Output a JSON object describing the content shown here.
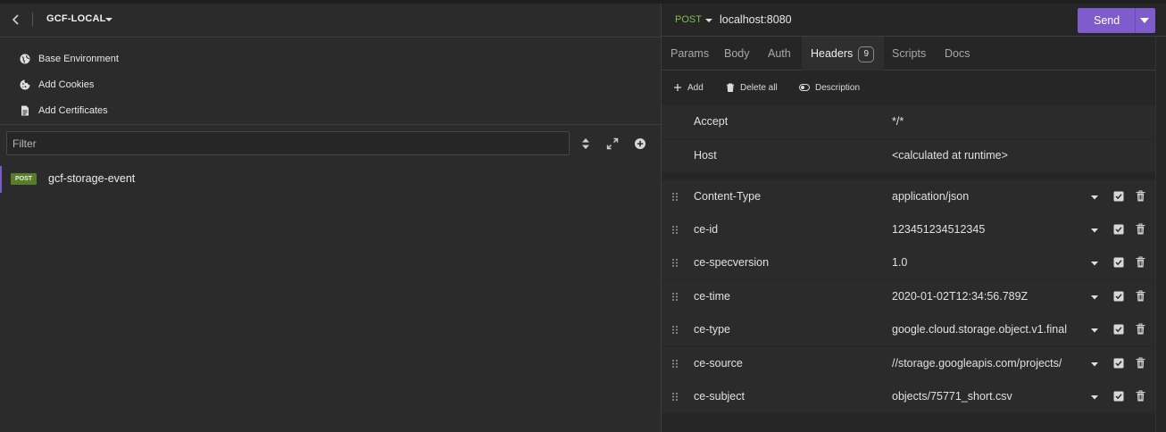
{
  "workspace": {
    "title": "GCF-LOCAL"
  },
  "environment_menu": {
    "items": [
      {
        "label": "Base Environment",
        "icon": "globe-icon"
      },
      {
        "label": "Add Cookies",
        "icon": "cookie-icon"
      },
      {
        "label": "Add Certificates",
        "icon": "file-icon"
      }
    ]
  },
  "filter": {
    "placeholder": "Filter"
  },
  "requests": [
    {
      "method": "POST",
      "name": "gcf-storage-event"
    }
  ],
  "request": {
    "method": "POST",
    "url": "localhost:8080",
    "send_label": "Send"
  },
  "tabs": [
    {
      "label": "Params"
    },
    {
      "label": "Body"
    },
    {
      "label": "Auth"
    },
    {
      "label": "Headers",
      "count": "9"
    },
    {
      "label": "Scripts"
    },
    {
      "label": "Docs"
    }
  ],
  "toolbar": {
    "add_label": "Add",
    "delete_all_label": "Delete all",
    "description_label": "Description"
  },
  "headers": [
    {
      "name": "Accept",
      "value": "*/*",
      "readonly": true
    },
    {
      "name": "Host",
      "value": "<calculated at runtime>",
      "readonly": true
    },
    {
      "name": "Content-Type",
      "value": "application/json"
    },
    {
      "name": "ce-id",
      "value": "123451234512345"
    },
    {
      "name": "ce-specversion",
      "value": "1.0"
    },
    {
      "name": "ce-time",
      "value": "2020-01-02T12:34:56.789Z"
    },
    {
      "name": "ce-type",
      "value": "google.cloud.storage.object.v1.final"
    },
    {
      "name": "ce-source",
      "value": "//storage.googleapis.com/projects/"
    },
    {
      "name": "ce-subject",
      "value": "objects/75771_short.csv"
    }
  ],
  "colors": {
    "accent": "#7e5ccc",
    "method_post": "#7bc043",
    "badge_post": "#5a7a2e"
  }
}
